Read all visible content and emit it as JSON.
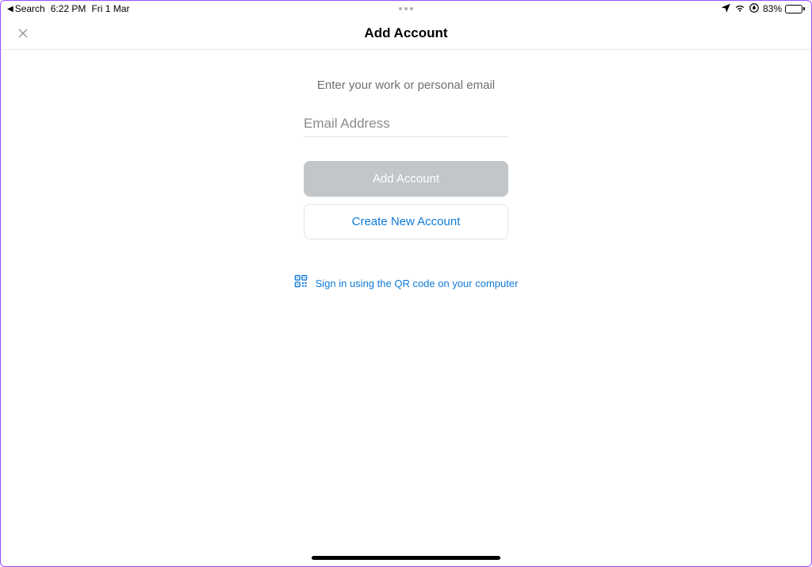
{
  "statusBar": {
    "backLabel": "Search",
    "time": "6:22 PM",
    "date": "Fri 1 Mar",
    "battery": "83%"
  },
  "nav": {
    "title": "Add Account"
  },
  "main": {
    "subtitle": "Enter your work or personal email",
    "emailPlaceholder": "Email Address",
    "addAccountLabel": "Add Account",
    "createAccountLabel": "Create New Account",
    "qrLinkText": "Sign in using the QR code on your computer"
  }
}
